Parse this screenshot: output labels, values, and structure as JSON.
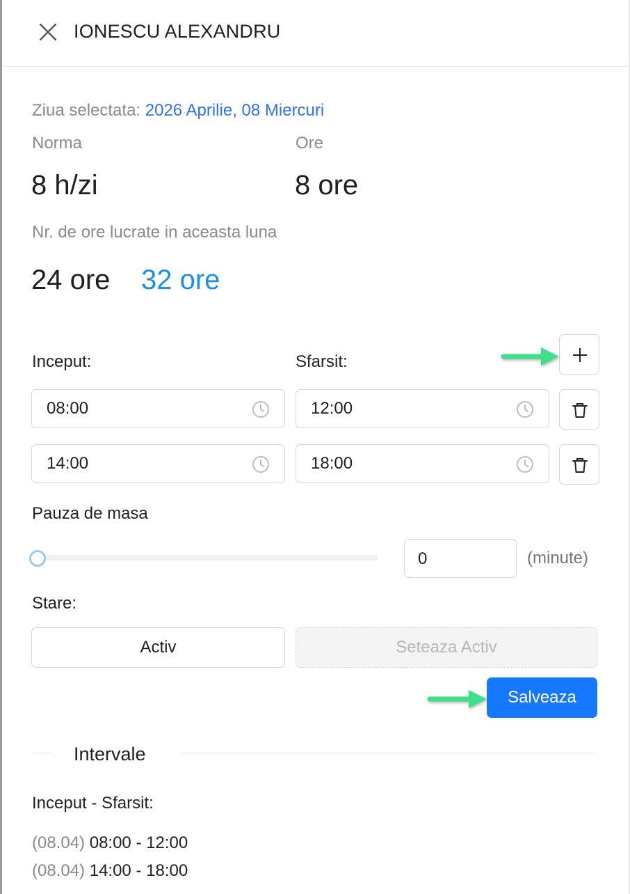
{
  "header": {
    "title": "IONESCU ALEXANDRU",
    "close_icon": "close-icon"
  },
  "selected_day": {
    "label": "Ziua selectata:",
    "value": "2026 Aprilie, 08 Miercuri"
  },
  "norma": {
    "label": "Norma",
    "value": "8 h/zi"
  },
  "ore": {
    "label": "Ore",
    "value": "8 ore"
  },
  "monthly": {
    "label": "Nr. de ore lucrate in aceasta luna",
    "worked": "24 ore",
    "total": "32 ore"
  },
  "schedule": {
    "start_label": "Inceput:",
    "end_label": "Sfarsit:",
    "add_icon": "plus-icon",
    "rows": [
      {
        "start": "08:00",
        "end": "12:00"
      },
      {
        "start": "14:00",
        "end": "18:00"
      }
    ]
  },
  "pause": {
    "label": "Pauza de masa",
    "value": "0",
    "slider_value": 0,
    "unit": "(minute)"
  },
  "status": {
    "label": "Stare:",
    "current": "Activ",
    "set_active": "Seteaza Activ"
  },
  "save_label": "Salveaza",
  "intervals": {
    "title": "Intervale",
    "header": "Inceput - Sfarsit:",
    "items": [
      {
        "date": "(08.04)",
        "range": "08:00 - 12:00"
      },
      {
        "date": "(08.04)",
        "range": "14:00 - 18:00"
      }
    ]
  },
  "colors": {
    "accent": "#1677ff",
    "link_blue": "#2f73e6",
    "total_blue": "#1e8ee9",
    "arrow_green": "#3fe08a"
  }
}
